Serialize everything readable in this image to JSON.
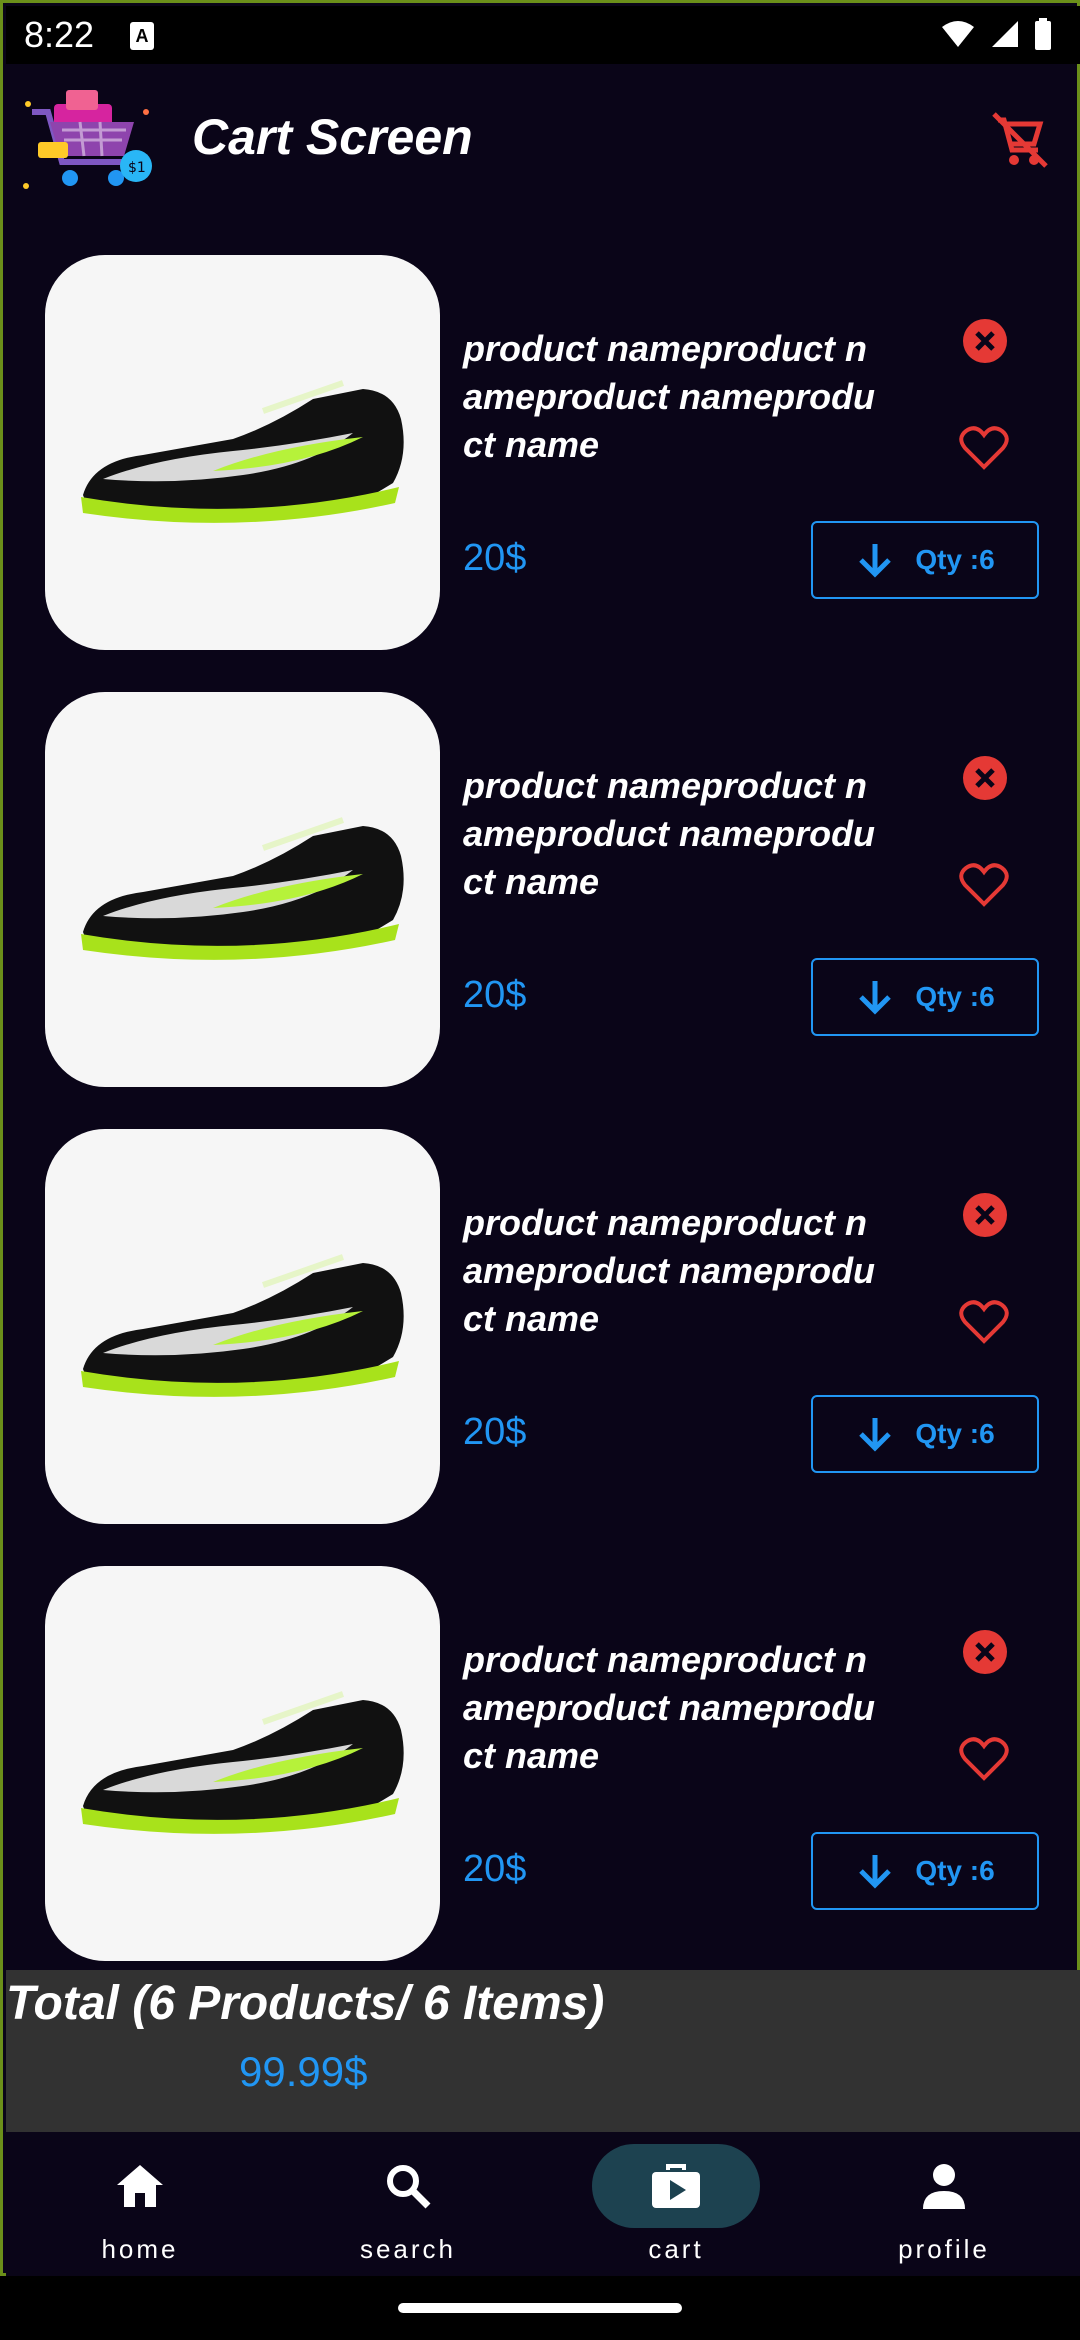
{
  "status_bar": {
    "time": "8:22",
    "notification_icon": "A"
  },
  "app_bar": {
    "title": "Cart Screen",
    "logo_icon": "shopping-cart-logo",
    "action_icon": "remove-shopping-cart-icon"
  },
  "colors": {
    "accent": "#2196f3",
    "danger": "#e53935",
    "background": "#0a0518",
    "total_bar": "#323232",
    "nav_active": "#1d4250"
  },
  "cart_items": [
    {
      "name": "product nameproduct nameproduct nameproduct name",
      "price": "20$",
      "qty_label": "Qty :6"
    },
    {
      "name": "product nameproduct nameproduct nameproduct name",
      "price": "20$",
      "qty_label": "Qty :6"
    },
    {
      "name": "product nameproduct nameproduct nameproduct name",
      "price": "20$",
      "qty_label": "Qty :6"
    },
    {
      "name": "product nameproduct nameproduct nameproduct name",
      "price": "20$",
      "qty_label": "Qty :6"
    }
  ],
  "total": {
    "label": "Total (6 Products/ 6 Items)",
    "value": "99.99$"
  },
  "bottom_nav": {
    "items": [
      {
        "label": "home",
        "icon": "home-icon"
      },
      {
        "label": "search",
        "icon": "search-icon"
      },
      {
        "label": "cart",
        "icon": "shopping-bag-icon",
        "active": true
      },
      {
        "label": "profile",
        "icon": "person-icon"
      }
    ]
  }
}
